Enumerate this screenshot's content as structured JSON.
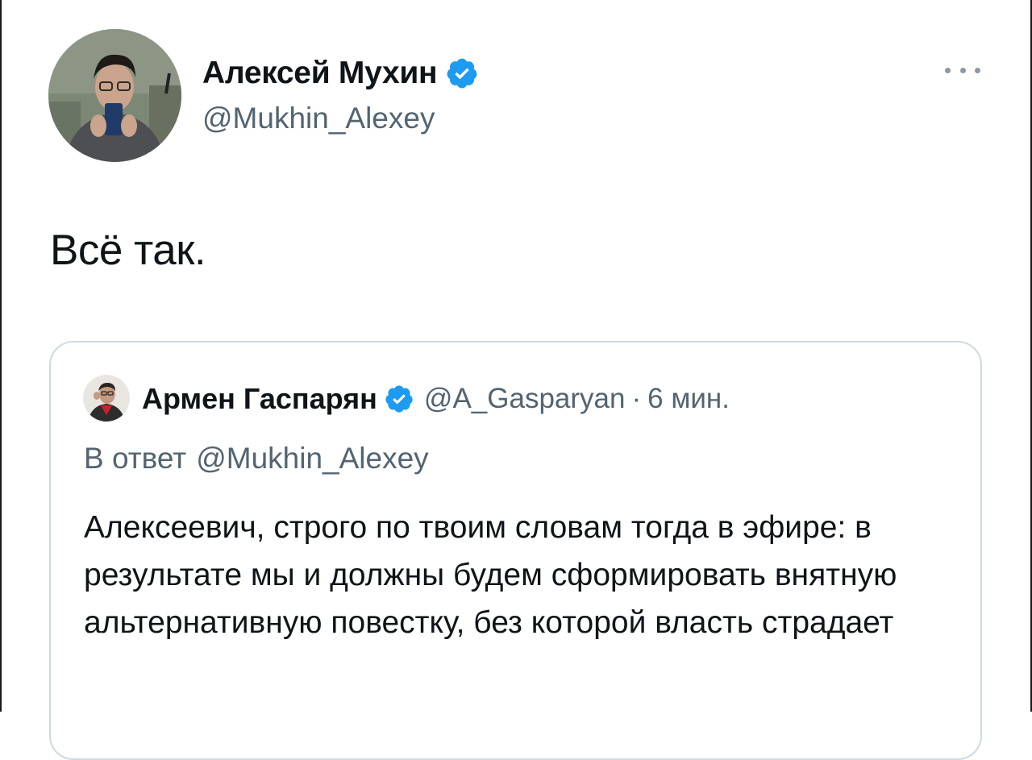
{
  "tweet": {
    "author": {
      "name": "Алексей Мухин",
      "handle": "@Mukhin_Alexey",
      "verified": true,
      "avatar_icon": "avatar-photo"
    },
    "more_icon": "more-horizontal-icon",
    "text": "Всё так."
  },
  "quoted_tweet": {
    "author": {
      "name": "Армен Гаспарян",
      "handle": "@A_Gasparyan",
      "verified": true,
      "avatar_icon": "avatar-photo"
    },
    "separator": "·",
    "time": "6 мин.",
    "reply_prefix": "В ответ",
    "reply_to": "@Mukhin_Alexey",
    "text": "Алексеевич, строго по твоим словам тогда в эфире: в результате мы и должны будем сформировать внятную альтернативную повестку, без которой власть страдает"
  },
  "colors": {
    "text_primary": "#0f1419",
    "text_secondary": "#536471",
    "verified": "#1d9bf0",
    "border": "#cfd9de"
  }
}
